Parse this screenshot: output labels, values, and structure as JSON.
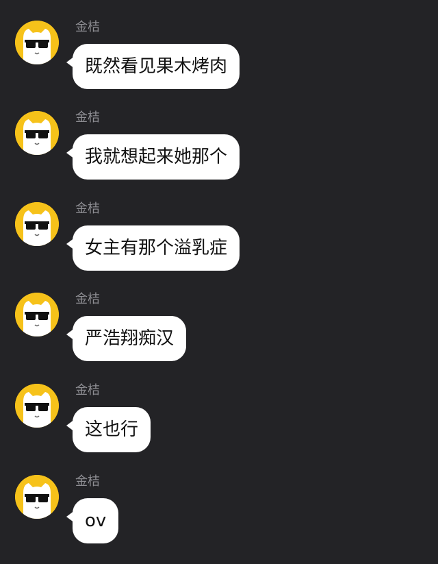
{
  "theme": {
    "background": "#232326",
    "bubble": "#ffffff",
    "sender_color": "#8e8e93",
    "avatar_bg": "#f6c21a"
  },
  "messages": [
    {
      "sender": "金桔",
      "text": "既然看见果木烤肉",
      "avatar_icon": "cat-sunglasses-avatar"
    },
    {
      "sender": "金桔",
      "text": "我就想起来她那个",
      "avatar_icon": "cat-sunglasses-avatar"
    },
    {
      "sender": "金桔",
      "text": "女主有那个溢乳症",
      "avatar_icon": "cat-sunglasses-avatar"
    },
    {
      "sender": "金桔",
      "text": "严浩翔痴汉",
      "avatar_icon": "cat-sunglasses-avatar"
    },
    {
      "sender": "金桔",
      "text": "这也行",
      "avatar_icon": "cat-sunglasses-avatar"
    },
    {
      "sender": "金桔",
      "text": "ov",
      "avatar_icon": "cat-sunglasses-avatar"
    }
  ]
}
